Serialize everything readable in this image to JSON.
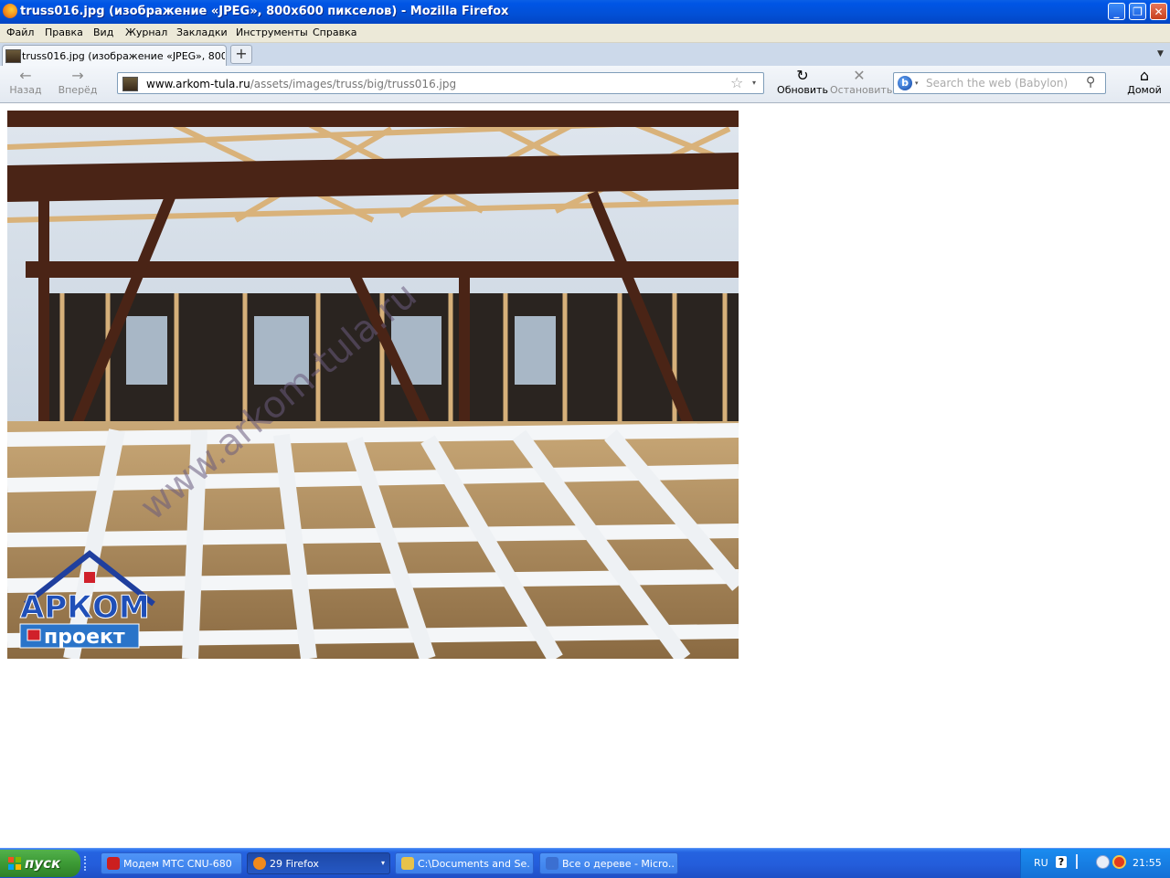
{
  "window": {
    "title": "truss016.jpg (изображение «JPEG», 800x600 пикселов) - Mozilla Firefox",
    "controls": {
      "minimize": "_",
      "maximize": "❐",
      "close": "✕"
    }
  },
  "menu": {
    "items": [
      "Файл",
      "Правка",
      "Вид",
      "Журнал",
      "Закладки",
      "Инструменты",
      "Справка"
    ]
  },
  "tabs": {
    "items": [
      {
        "label": "truss016.jpg (изображение «JPEG», 800x6..."
      }
    ],
    "new_tab": "+",
    "list_arrow": "▼"
  },
  "navigation": {
    "back_label": "Назад",
    "forward_label": "Вперёд",
    "reload_label": "Обновить",
    "stop_label": "Остановить",
    "home_label": "Домой",
    "back_icon": "←",
    "forward_icon": "→",
    "reload_icon": "↻",
    "stop_icon": "✕",
    "home_icon": "⌂"
  },
  "address": {
    "host": "www.arkom-tula.ru",
    "path": "/assets/images/truss/big/truss016.jpg",
    "star_icon": "☆",
    "dropdown_icon": "▾"
  },
  "search": {
    "placeholder": "Search the web (Babylon)",
    "engine_icon": "b",
    "dropdown_icon": "▾",
    "go_icon": "⚲"
  },
  "image": {
    "watermark": "www.arkom-tula.ru",
    "logo_top": "АРКОМ",
    "logo_bottom": "проект"
  },
  "taskbar": {
    "start_label": "пуск",
    "tasks": [
      {
        "label": "Модем МТС CNU-680",
        "icon_color": "#cc1f1f"
      },
      {
        "label": "29 Firefox",
        "icon_color": "#f28a1c"
      },
      {
        "label": "C:\\Documents and Se...",
        "icon_color": "#e8c24a"
      },
      {
        "label": "Все о дереве - Micro...",
        "icon_color": "#3b6fd1"
      }
    ],
    "task_dropdown": "▾",
    "tray": {
      "lang": "RU",
      "help": "?",
      "time": "21:55"
    }
  },
  "colors": {
    "title_bar": "#0055e5",
    "taskbar": "#245ddb",
    "start_button": "#3c9a35",
    "tray": "#1470d6"
  }
}
